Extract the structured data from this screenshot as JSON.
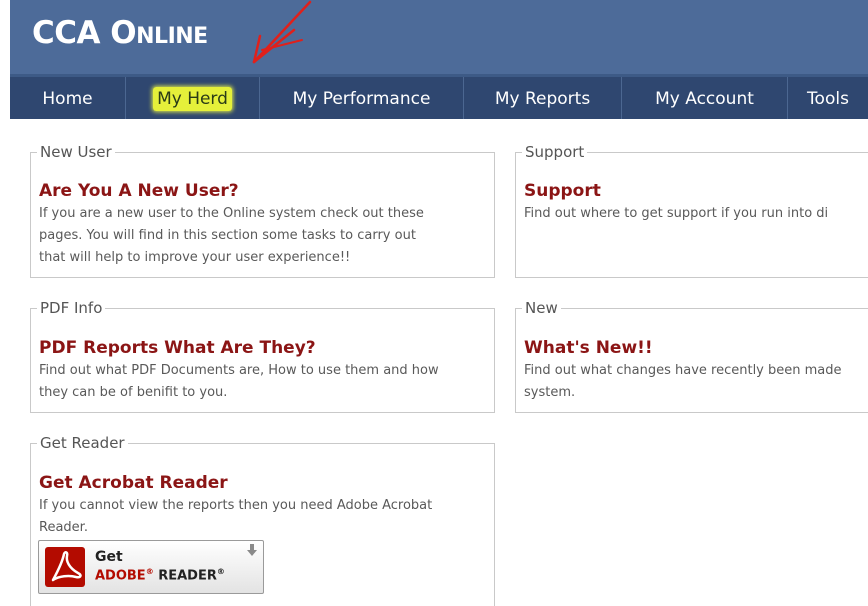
{
  "header": {
    "brand": "CCA Online"
  },
  "nav": {
    "items": [
      {
        "label": "Home"
      },
      {
        "label": "My Herd"
      },
      {
        "label": "My Performance"
      },
      {
        "label": "My Reports"
      },
      {
        "label": "My Account"
      },
      {
        "label": "Tools"
      }
    ]
  },
  "panels": {
    "new_user": {
      "legend": "New User",
      "title": "Are You A New User?",
      "lines": [
        "If you are a new user to the Online system check out these",
        "pages. You will find in this section some tasks to carry out",
        "that will help to improve your user experience!!"
      ]
    },
    "support": {
      "legend": "Support",
      "title": "Support",
      "lines": [
        "Find out where to get support if you run into di"
      ]
    },
    "pdf_info": {
      "legend": "PDF Info",
      "title": "PDF Reports What Are They?",
      "lines": [
        "Find out what PDF Documents are, How to use them and how",
        "they can be of benifit to you."
      ]
    },
    "new": {
      "legend": "New",
      "title": "What's New!!",
      "lines": [
        "Find out what changes have recently been made",
        "system."
      ]
    },
    "get_reader": {
      "legend": "Get Reader",
      "title": "Get Acrobat Reader",
      "lines": [
        "If you cannot view the reports then you need Adobe Acrobat",
        "Reader."
      ],
      "badge": {
        "get": "Get",
        "adobe": "ADOBE",
        "reg": "®",
        "reader": " READER",
        "reg2": "®"
      }
    }
  },
  "colors": {
    "header_bg": "#4d6b99",
    "nav_bg": "#2f4770",
    "title_red": "#8b1515",
    "highlight": "#e5f03a",
    "annotation": "#e0201b"
  }
}
